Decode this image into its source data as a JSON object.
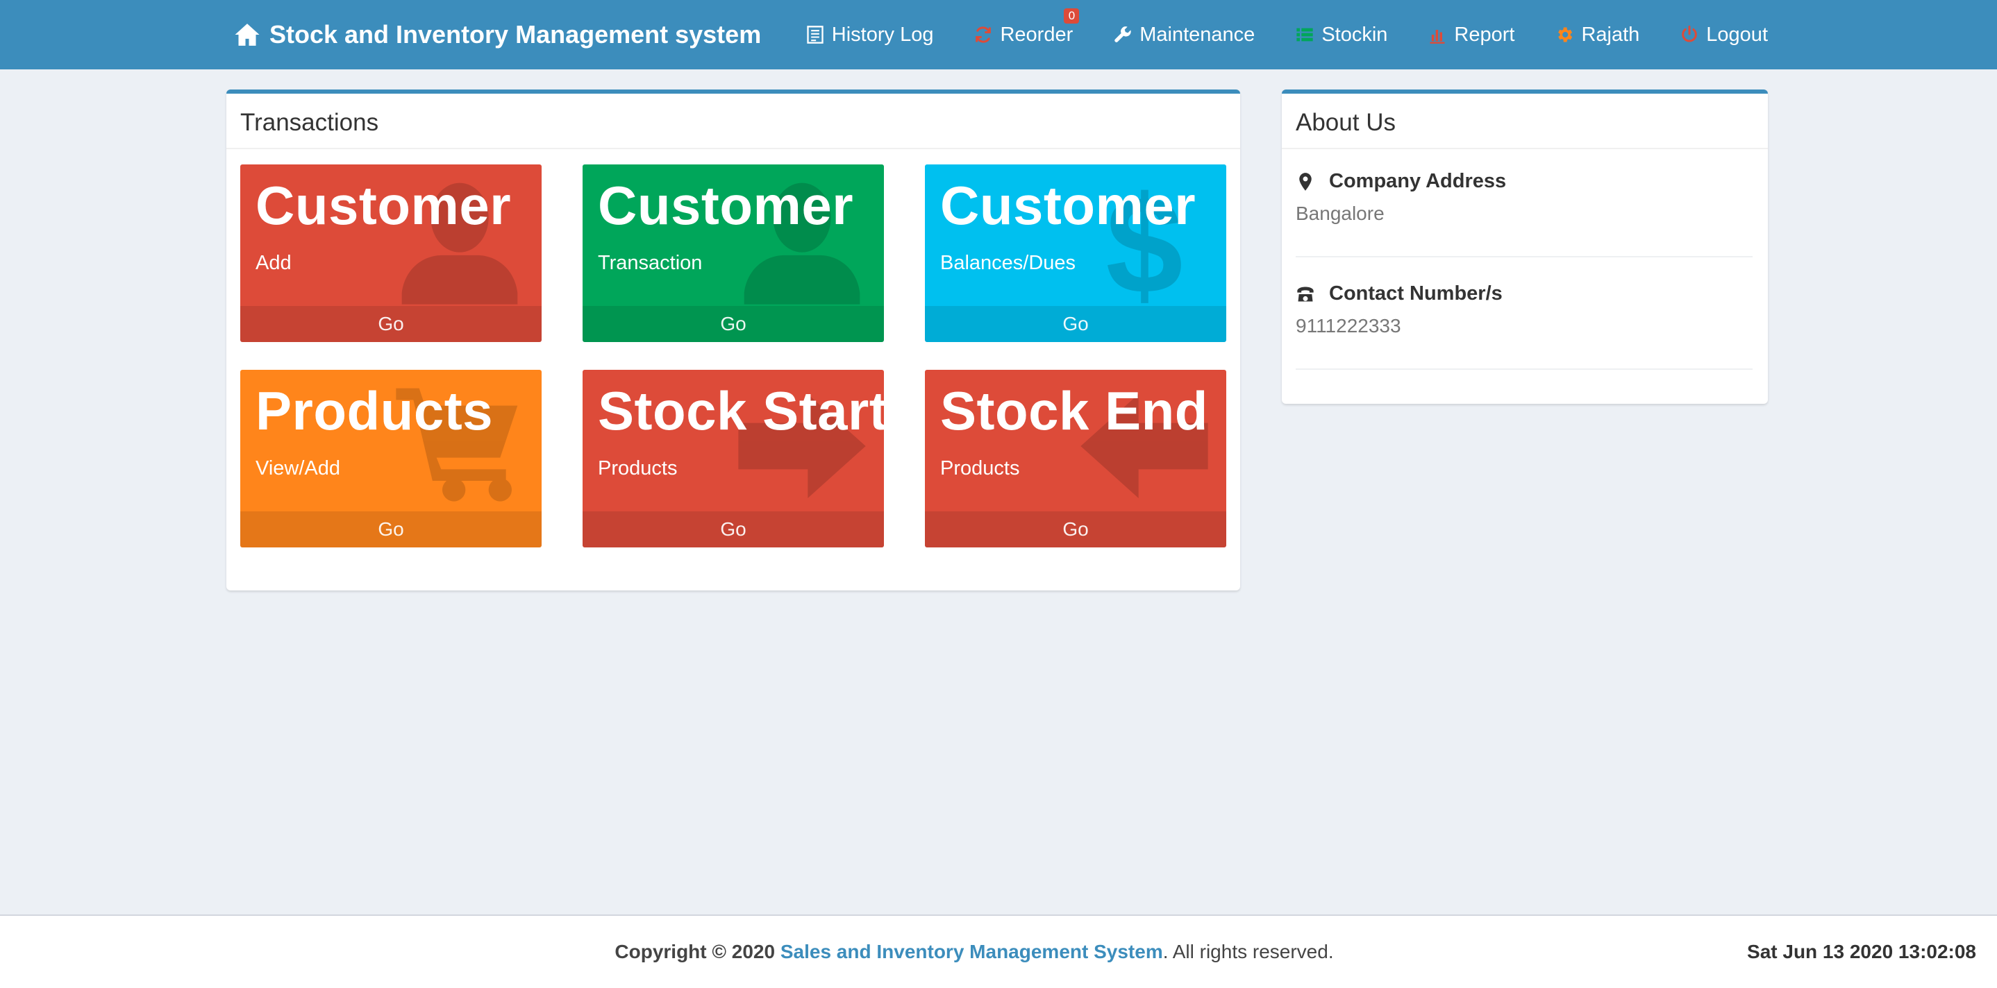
{
  "navbar": {
    "brand": "Stock and Inventory Management system",
    "items": [
      {
        "label": "History Log",
        "icon": "list-icon"
      },
      {
        "label": "Reorder",
        "icon": "refresh-icon",
        "badge": "0"
      },
      {
        "label": "Maintenance",
        "icon": "wrench-icon"
      },
      {
        "label": "Stockin",
        "icon": "table-list-icon"
      },
      {
        "label": "Report",
        "icon": "bar-chart-icon"
      },
      {
        "label": "Rajath",
        "icon": "gear-icon"
      },
      {
        "label": "Logout",
        "icon": "power-icon"
      }
    ],
    "colors": {
      "bar": "#3c8dbc",
      "reorder_icon": "#dd4b39",
      "stockin_icon": "#00a65a",
      "report_icon": "#dd4b39",
      "user_icon": "#ff851b",
      "logout_icon": "#dd4b39"
    }
  },
  "transactions": {
    "title": "Transactions",
    "tiles": [
      {
        "title": "Customer",
        "sub": "Add",
        "footer": "Go",
        "color": "#dd4b39",
        "icon": "user-icon"
      },
      {
        "title": "Customer",
        "sub": "Transaction",
        "footer": "Go",
        "color": "#00a65a",
        "icon": "user-icon"
      },
      {
        "title": "Customer",
        "sub": "Balances/Dues",
        "footer": "Go",
        "color": "#00c0ef",
        "icon": "dollar-icon"
      },
      {
        "title": "Products",
        "sub": "View/Add",
        "footer": "Go",
        "color": "#ff851b",
        "icon": "cart-icon"
      },
      {
        "title": "Stock Start",
        "sub": "Products",
        "footer": "Go",
        "color": "#dd4b39",
        "icon": "arrow-right-icon"
      },
      {
        "title": "Stock End",
        "sub": "Products",
        "footer": "Go",
        "color": "#dd4b39",
        "icon": "arrow-left-icon"
      }
    ]
  },
  "about": {
    "title": "About Us",
    "address_label": "Company Address",
    "address_value": "Bangalore",
    "contact_label": "Contact Number/s",
    "contact_value": "9111222333"
  },
  "footer": {
    "copyright_prefix": "Copyright © 2020",
    "company_link": "Sales and Inventory Management System",
    "suffix": ". All rights reserved.",
    "datetime": "Sat Jun 13 2020 13:02:08"
  }
}
